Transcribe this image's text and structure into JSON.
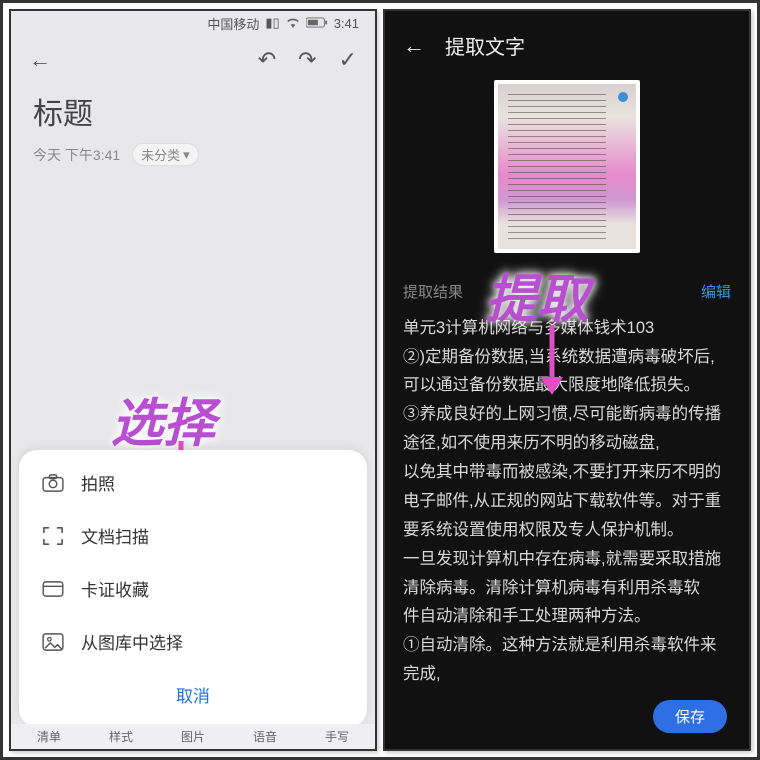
{
  "left": {
    "statusbar": {
      "carrier": "中国移动",
      "time": "3:41"
    },
    "title": "标题",
    "timestamp": "今天 下午3:41",
    "tag": "未分类",
    "annotation": "选择",
    "sheet": {
      "items": [
        {
          "icon": "camera-icon",
          "label": "拍照"
        },
        {
          "icon": "scan-icon",
          "label": "文档扫描"
        },
        {
          "icon": "card-icon",
          "label": "卡证收藏"
        },
        {
          "icon": "gallery-icon",
          "label": "从图库中选择"
        }
      ],
      "cancel": "取消"
    },
    "tabs": [
      "清单",
      "样式",
      "图片",
      "语音",
      "手写"
    ]
  },
  "right": {
    "title": "提取文字",
    "annotation": "提取",
    "result_label": "提取结果",
    "edit_label": "编辑",
    "result_text": "单元3计算机网络与多媒体钱术103\n②)定期备份数据,当系统数据遭病毒破坏后,可以通过备份数据最大限度地降低损失。\n③养成良好的上网习惯,尽可能断病毒的传播途径,如不使用来历不明的移动磁盘,\n以免其中带毒而被感染,不要打开来历不明的电子邮件,从正规的网站下载软件等。对于重\n要系统设置使用权限及专人保护机制。\n一旦发现计算机中存在病毒,就需要采取措施清除病毒。清除计算机病毒有利用杀毒软\n件自动清除和手工处理两种方法。\n①自动清除。这种方法就是利用杀毒软件来完成,",
    "save": "保存"
  }
}
